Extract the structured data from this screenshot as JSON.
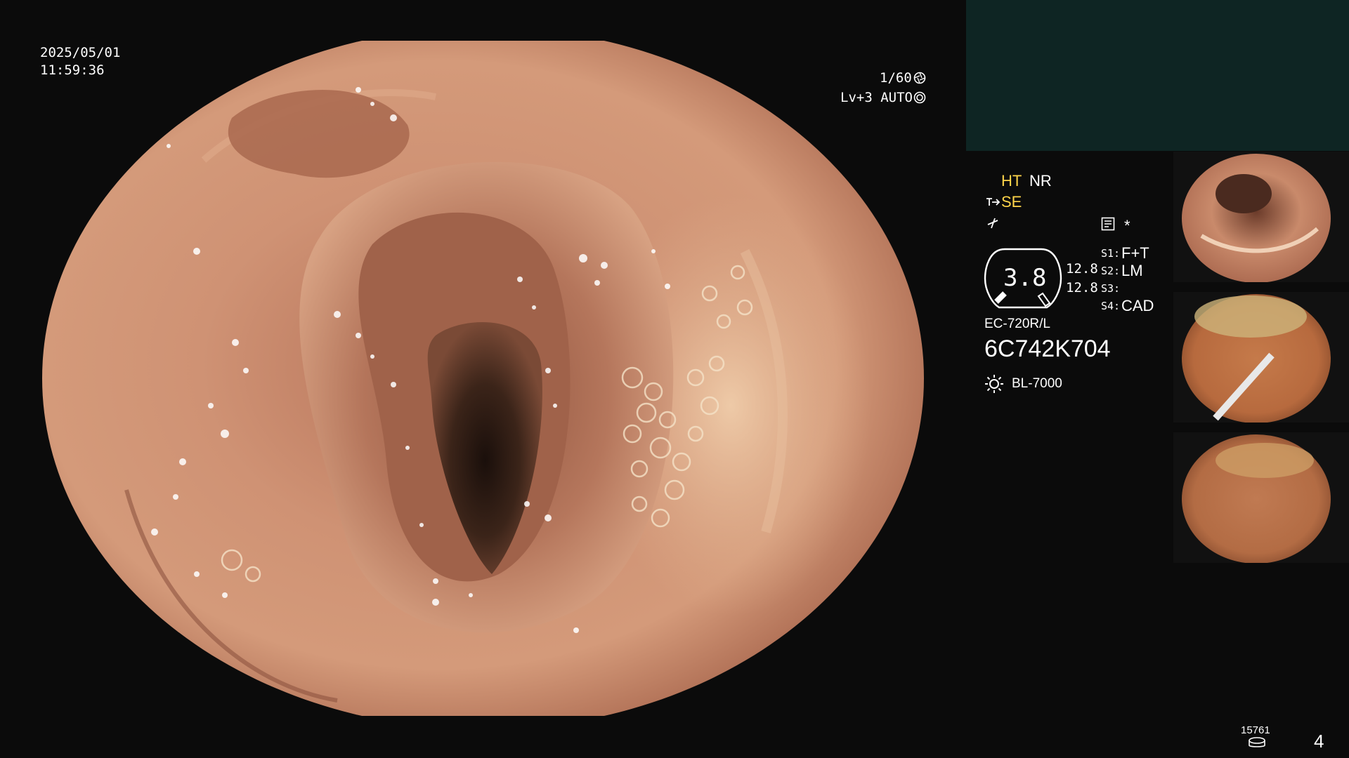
{
  "overlay": {
    "date": "2025/05/01",
    "time": "11:59:36",
    "shutter": "1/60",
    "level_mode": "Lv+3 AUTO",
    "ht_label": "HT",
    "nr_label": "NR",
    "se_label": "SE",
    "asterisk": "*",
    "gauge_value": "3.8",
    "gauge_sub_top": "12.8",
    "gauge_sub_bottom": "12.8",
    "s1_label": "S1:",
    "s1_value": "F+T",
    "s2_label": "S2:",
    "s2_value": "LM",
    "s3_label": "S3:",
    "s3_value": "",
    "s4_label": "S4:",
    "s4_value": "CAD",
    "scope_model": "EC-720R/L",
    "scope_serial": "6C742K704",
    "light_source": "BL-7000",
    "counter": "15761",
    "page_number": "4"
  },
  "colors": {
    "accent_yellow": "#ffd54a",
    "panel_teal": "#0e2523",
    "mucosa": "#c9886a"
  },
  "icons": {
    "shutter": "aperture-icon",
    "auto": "auto-exposure-icon",
    "se": "scope-tip-icon",
    "enhance": "enhance-icon",
    "record": "record-icon",
    "light": "light-sun-icon",
    "storage": "storage-disk-icon"
  }
}
